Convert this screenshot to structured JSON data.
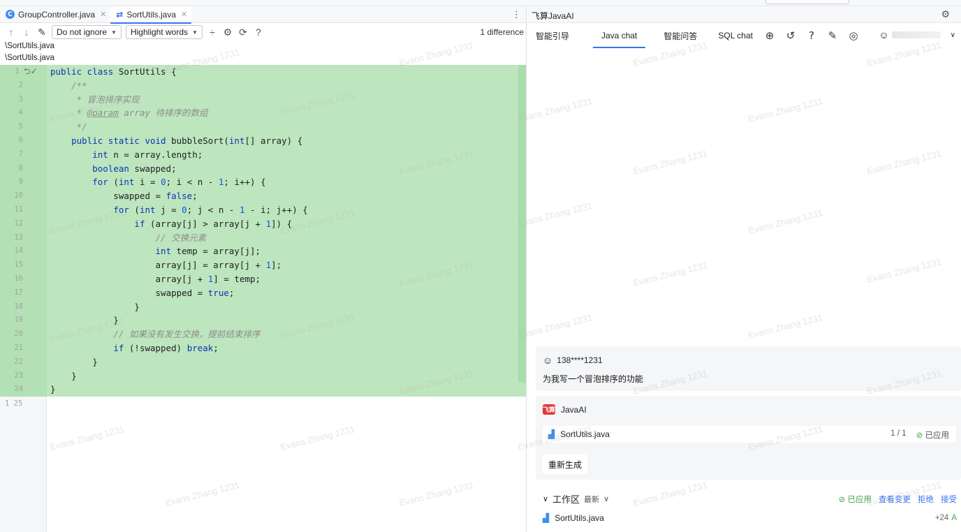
{
  "editor": {
    "tabs": [
      {
        "label": "GroupController.java",
        "icon": "class-icon"
      },
      {
        "label": "SortUtils.java",
        "icon": "diff-icon",
        "active": true
      }
    ],
    "toolbar": {
      "ignore_option": "Do not ignore",
      "highlight_option": "Highlight words",
      "diff_count": "1 difference"
    },
    "paths": [
      "\\SortUtils.java",
      "\\SortUtils.java"
    ],
    "left_line_marker": "1 25",
    "lines": [
      {
        "n": "1",
        "html": "<span class=\"kw\">public class</span> SortUtils {"
      },
      {
        "n": "2",
        "html": "    <span class=\"cm\">/**</span>"
      },
      {
        "n": "3",
        "html": "    <span class=\"cm\"> * 冒泡排序实现</span>"
      },
      {
        "n": "4",
        "html": "    <span class=\"cm\"> * </span><span class=\"tag\">@param</span><span class=\"cm\"> array 待排序的数组</span>"
      },
      {
        "n": "5",
        "html": "    <span class=\"cm\"> */</span>"
      },
      {
        "n": "6",
        "html": "    <span class=\"kw\">public static void</span> bubbleSort(<span class=\"kw\">int</span>[] array) {"
      },
      {
        "n": "7",
        "html": "        <span class=\"kw\">int</span> n = array.length;"
      },
      {
        "n": "8",
        "html": "        <span class=\"kw\">boolean</span> swapped;"
      },
      {
        "n": "9",
        "html": "        <span class=\"kw\">for</span> (<span class=\"kw\">int</span> i = <span class=\"num\">0</span>; i &lt; n - <span class=\"num\">1</span>; i++) {"
      },
      {
        "n": "10",
        "html": "            swapped = <span class=\"kw\">false</span>;"
      },
      {
        "n": "11",
        "html": "            <span class=\"kw\">for</span> (<span class=\"kw\">int</span> j = <span class=\"num\">0</span>; j &lt; n - <span class=\"num\">1</span> - i; j++) {"
      },
      {
        "n": "12",
        "html": "                <span class=\"kw\">if</span> (array[j] &gt; array[j + <span class=\"num\">1</span>]) {"
      },
      {
        "n": "13",
        "html": "                    <span class=\"cm\">// 交换元素</span>"
      },
      {
        "n": "14",
        "html": "                    <span class=\"kw\">int</span> temp = array[j];"
      },
      {
        "n": "15",
        "html": "                    array[j] = array[j + <span class=\"num\">1</span>];"
      },
      {
        "n": "16",
        "html": "                    array[j + <span class=\"num\">1</span>] = temp;"
      },
      {
        "n": "17",
        "html": "                    swapped = <span class=\"kw\">true</span>;"
      },
      {
        "n": "18",
        "html": "                }"
      },
      {
        "n": "19",
        "html": "            }"
      },
      {
        "n": "20",
        "html": "            <span class=\"cm\">// 如果没有发生交换，提前结束排序</span>"
      },
      {
        "n": "21",
        "html": "            <span class=\"kw\">if</span> (!swapped) <span class=\"kw\">break</span>;"
      },
      {
        "n": "22",
        "html": "        }"
      },
      {
        "n": "23",
        "html": "    }"
      },
      {
        "n": "24",
        "html": "}"
      }
    ]
  },
  "assistant": {
    "title": "飞算JavaAI",
    "nav_tabs": [
      "智能引导",
      "Java chat",
      "智能问答",
      "SQL chat"
    ],
    "active_tab": "Java chat",
    "user_message": {
      "user": "138****1231",
      "text": "为我写一个冒泡排序的功能"
    },
    "ai_message": {
      "name": "JavaAI",
      "logo_text": "飞算",
      "file": "SortUtils.java",
      "count": "1 / 1",
      "status": "已应用",
      "regen_label": "重新生成"
    },
    "workarea": {
      "title": "工作区",
      "sort": "最新",
      "status": "已应用",
      "view_changes": "查看变更",
      "reject": "拒绝",
      "accept": "接受",
      "file": "SortUtils.java",
      "added": "+24",
      "badge": "A"
    },
    "watermark": "Evans Zhang 1231"
  }
}
